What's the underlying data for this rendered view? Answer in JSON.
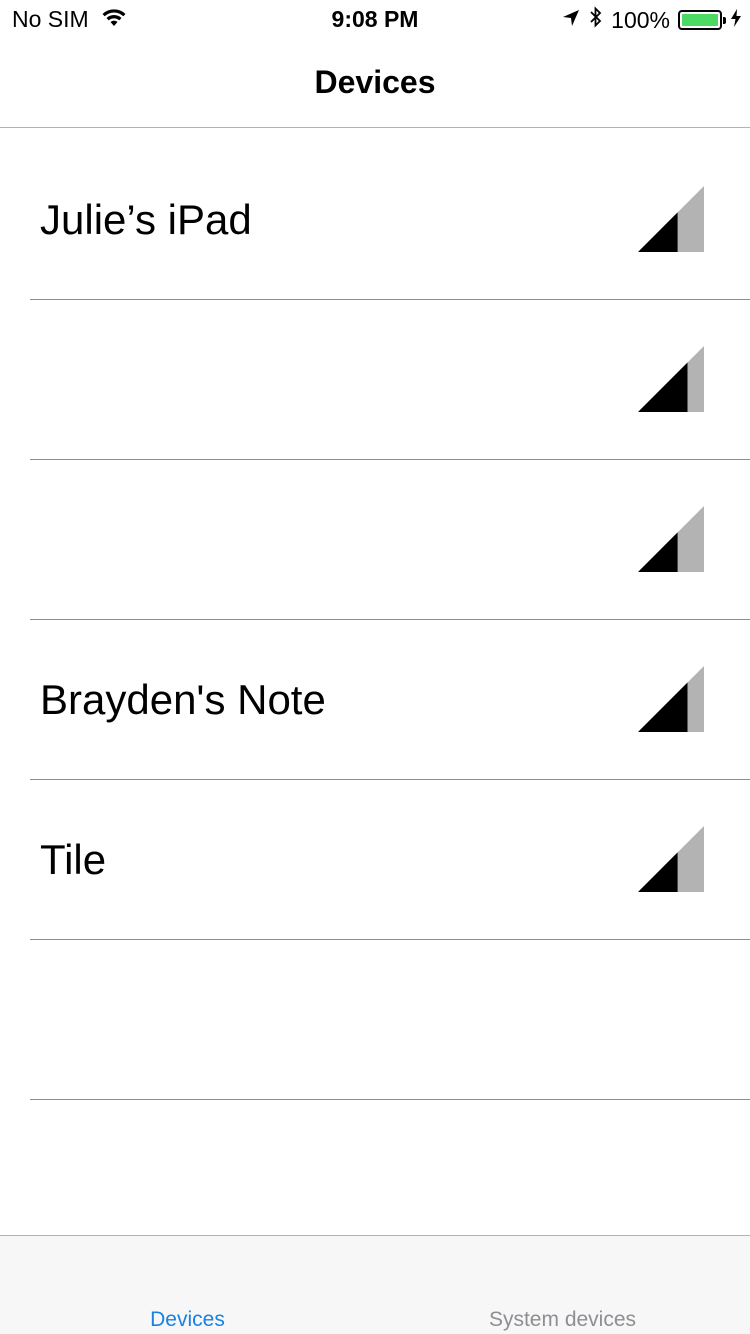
{
  "status_bar": {
    "carrier": "No SIM",
    "time": "9:08 PM",
    "battery_text": "100%",
    "battery_level": 1.0,
    "icons": [
      "wifi-icon",
      "location-arrow-icon",
      "bluetooth-icon",
      "battery-icon",
      "charging-bolt-icon"
    ]
  },
  "nav": {
    "title": "Devices"
  },
  "devices": [
    {
      "name": "Julie’s iPad",
      "signal_level": 0.6
    },
    {
      "name": "",
      "signal_level": 0.75
    },
    {
      "name": "",
      "signal_level": 0.6
    },
    {
      "name": "Brayden's Note",
      "signal_level": 0.75
    },
    {
      "name": "Tile",
      "signal_level": 0.6
    },
    {
      "name": "",
      "signal_level": null
    }
  ],
  "tab_bar": {
    "tabs": [
      {
        "label": "Devices",
        "selected": true
      },
      {
        "label": "System devices",
        "selected": false
      }
    ]
  },
  "colors": {
    "accent": "#1a82e2",
    "battery": "#4cd964",
    "signal_filled": "#000000",
    "signal_empty": "#b3b3b3",
    "tab_inactive": "#8e8e93"
  }
}
